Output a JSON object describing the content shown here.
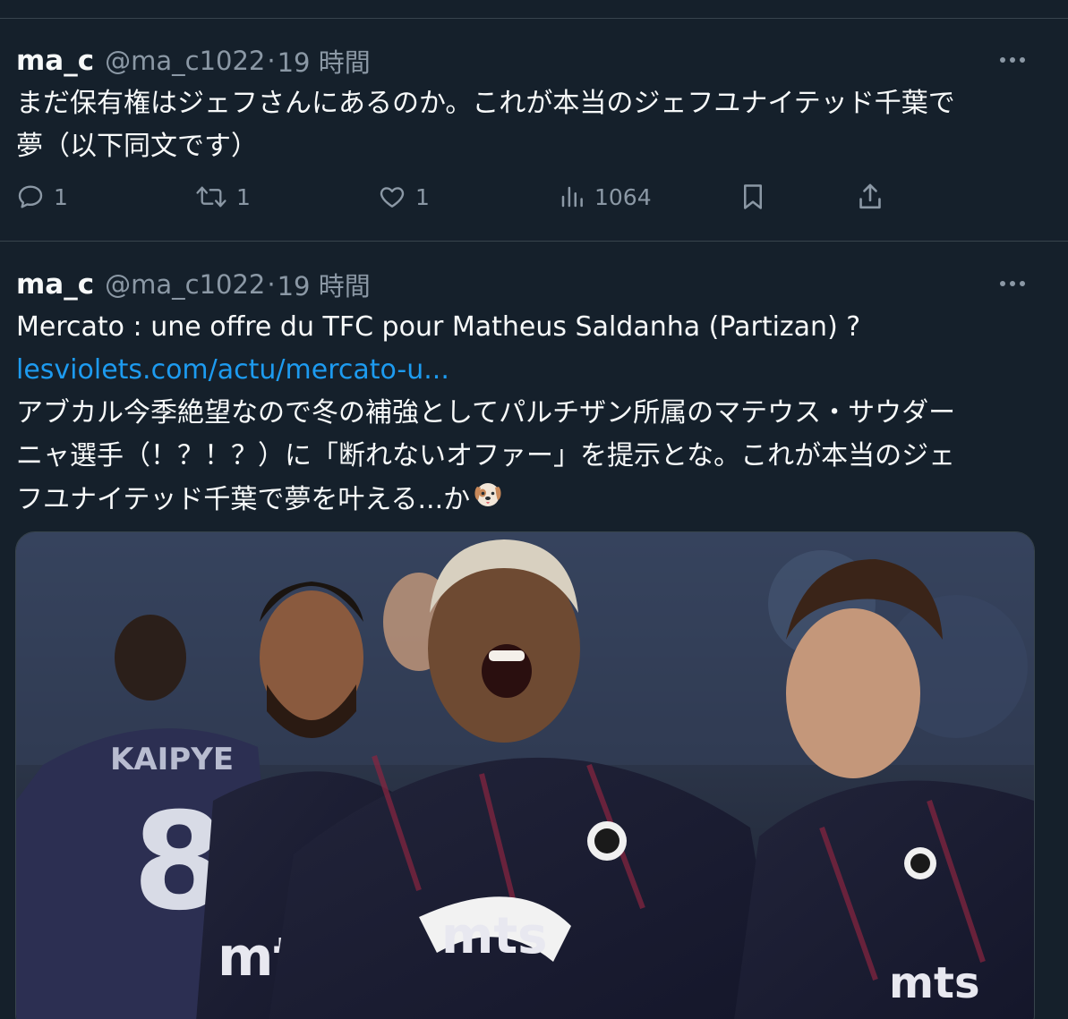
{
  "tweets": [
    {
      "display_name": "ma_c",
      "handle": "@ma_c1022",
      "separator": "·",
      "time": "19 時間",
      "text_lines": [
        "まだ保有権はジェフさんにあるのか。これが本当のジェフユナイテッド千葉で",
        "夢（以下同文です）"
      ],
      "actions": {
        "reply_count": "1",
        "retweet_count": "1",
        "like_count": "1",
        "view_count": "1064"
      }
    },
    {
      "display_name": "ma_c",
      "handle": "@ma_c1022",
      "separator": "·",
      "time": "19 時間",
      "headline": "Mercato : une offre du TFC pour Matheus Saldanha (Partizan) ?",
      "link_text": "lesviolets.com/actu/mercato-u...",
      "text_lines": [
        "アブカル今季絶望なので冬の補強としてパルチザン所属のマテウス・サウダー",
        "ニャ選手（！？！？）に「断れないオファー」を提示とな。これが本当のジェ",
        "フユナイテッド千葉で夢を叶える...か"
      ],
      "emoji": "dog-face",
      "media": {
        "jersey_text_left": "mts",
        "jersey_text_center": "mts",
        "jersey_text_right": "mts",
        "back_number": "8",
        "back_name": "KAIPYE"
      }
    }
  ],
  "colors": {
    "background": "#15202b",
    "text": "#f7f9f9",
    "secondary": "#8b98a5",
    "link": "#1d9bf0",
    "divider": "#38444d"
  },
  "icons": {
    "more": "more-horizontal-icon",
    "reply": "reply-icon",
    "retweet": "retweet-icon",
    "like": "heart-icon",
    "views": "views-icon",
    "bookmark": "bookmark-icon",
    "share": "share-icon"
  }
}
